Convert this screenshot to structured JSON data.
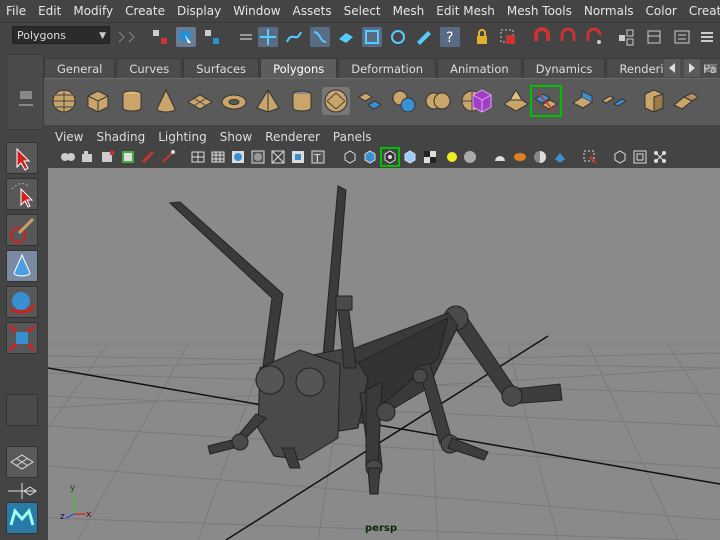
{
  "menubar": {
    "items": [
      "File",
      "Edit",
      "Modify",
      "Create",
      "Display",
      "Window",
      "Assets",
      "Select",
      "Mesh",
      "Edit Mesh",
      "Mesh Tools",
      "Normals",
      "Color",
      "Create UVs"
    ]
  },
  "statusline": {
    "mode_select": {
      "value": "Polygons"
    }
  },
  "shelf": {
    "tabs": [
      {
        "label": "General",
        "active": false
      },
      {
        "label": "Curves",
        "active": false
      },
      {
        "label": "Surfaces",
        "active": false
      },
      {
        "label": "Polygons",
        "active": true
      },
      {
        "label": "Deformation",
        "active": false
      },
      {
        "label": "Animation",
        "active": false
      },
      {
        "label": "Dynamics",
        "active": false
      },
      {
        "label": "Rendering",
        "active": false
      },
      {
        "label": "Pa",
        "active": false
      }
    ]
  },
  "panel": {
    "menus": [
      "View",
      "Shading",
      "Lighting",
      "Show",
      "Renderer",
      "Panels"
    ]
  },
  "viewport": {
    "camera": "persp",
    "axis_labels": {
      "x": "x",
      "y": "y",
      "z": "z"
    }
  },
  "colors": {
    "viewport_bg": "#8a8a8a",
    "ui_bg": "#444444",
    "model": "#3a3a3a",
    "highlight_green": "#00c000"
  }
}
